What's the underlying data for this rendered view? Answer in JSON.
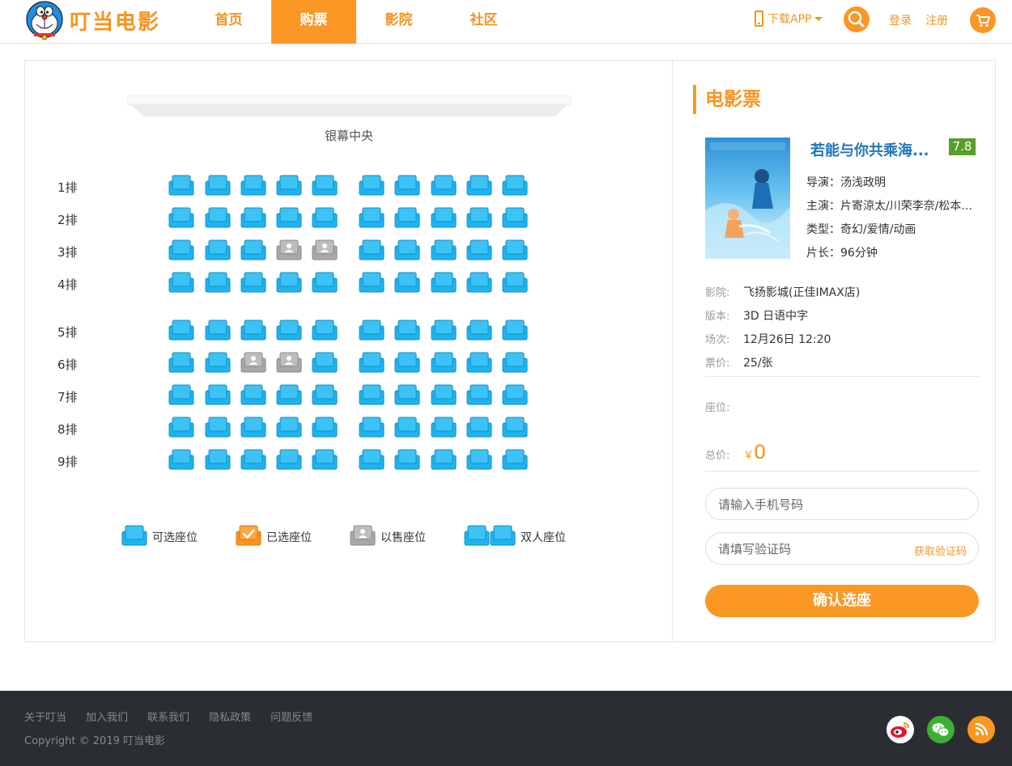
{
  "brand": {
    "name": "叮当电影"
  },
  "nav": {
    "items": [
      {
        "label": "首页",
        "active": false
      },
      {
        "label": "购票",
        "active": true
      },
      {
        "label": "影院",
        "active": false
      },
      {
        "label": "社区",
        "active": false
      }
    ],
    "download_label": "下载APP",
    "login_label": "登录",
    "register_label": "注册"
  },
  "hall": {
    "screen_label": "银幕中央",
    "rows": [
      "1排",
      "2排",
      "3排",
      "4排",
      "5排",
      "6排",
      "7排",
      "8排",
      "9排"
    ],
    "seats_per_row": 10,
    "sold_seats": [
      {
        "row": 3,
        "seat": 4
      },
      {
        "row": 3,
        "seat": 5
      },
      {
        "row": 6,
        "seat": 3
      },
      {
        "row": 6,
        "seat": 4
      }
    ],
    "legend": [
      {
        "type": "available",
        "label": "可选座位"
      },
      {
        "type": "selected",
        "label": "已选座位"
      },
      {
        "type": "sold",
        "label": "以售座位"
      },
      {
        "type": "couple",
        "label": "双人座位"
      }
    ]
  },
  "ticket": {
    "heading": "电影票",
    "movie": {
      "title": "若能与你共乘海...",
      "score": "7.8",
      "director_label": "导演：",
      "director": "汤浅政明",
      "cast_label": "主演：",
      "cast": "片寄涼太/川荣李奈/松本...",
      "genre_label": "类型：",
      "genre": "奇幻/爱情/动画",
      "duration_label": "片长：",
      "duration": "96分钟"
    },
    "cinema_label": "影院:",
    "cinema": "飞扬影城(正佳IMAX店)",
    "version_label": "版本:",
    "version": "3D 日语中字",
    "showtime_label": "场次:",
    "showtime": "12月26日 12:20",
    "price_label": "票价:",
    "price": "25/张",
    "seats_label": "座位:",
    "total_label": "总价:",
    "total_currency": "￥",
    "total_value": "0",
    "phone_placeholder": "请输入手机号码",
    "code_placeholder": "请填写验证码",
    "get_code_label": "获取验证码",
    "confirm_label": "确认选座"
  },
  "footer": {
    "links": [
      "关于叮当",
      "加入我们",
      "联系我们",
      "隐私政策",
      "问题反馈"
    ],
    "copyright": "Copyright © 2019 叮当电影",
    "social": [
      "weibo-icon",
      "wechat-icon",
      "rss-icon"
    ]
  },
  "colors": {
    "brand": "#fb9724",
    "seat_available": "#1fb4f0",
    "seat_sold": "#a8a8a8",
    "score": "#5a9e2a",
    "movie_title": "#1f76b7",
    "footer_bg": "#2a2e32"
  }
}
